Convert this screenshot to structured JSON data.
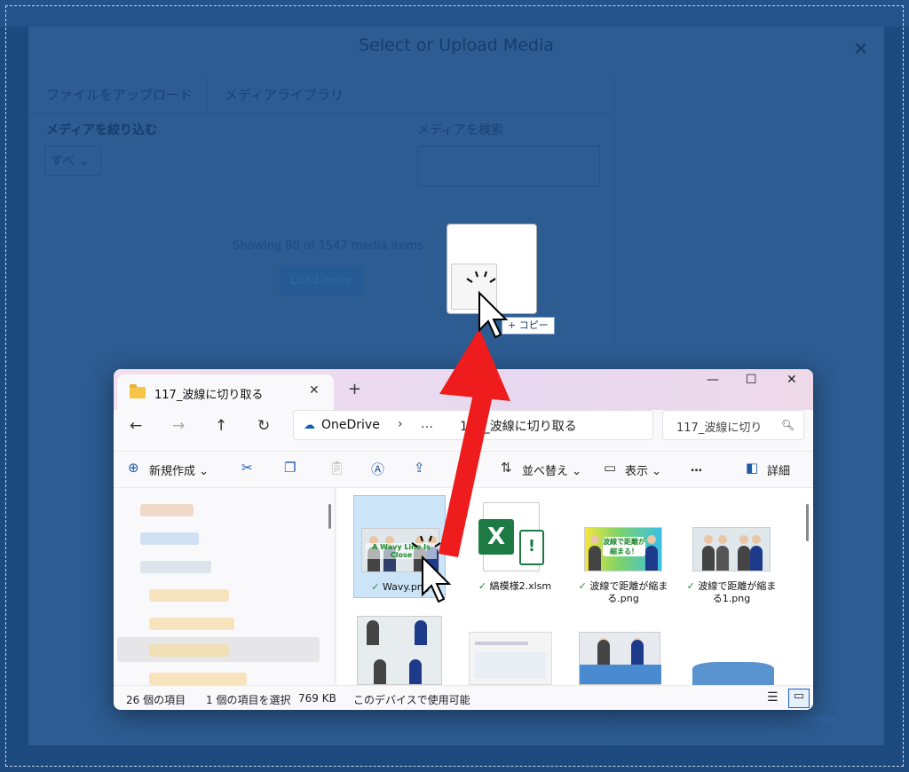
{
  "modal": {
    "title": "Select or Upload Media",
    "close": "×",
    "tabs": [
      "ファイルをアップロード",
      "メディアライブラリ"
    ],
    "filter_label": "メディアを絞り込む",
    "filter_value": "すべ",
    "search_label": "メディアを検索",
    "showing": "Showing 80 of 1547 media items",
    "load_more": "Load more",
    "select_button": "media"
  },
  "drag": {
    "copy_label": "+ コピー"
  },
  "explorer": {
    "tab_title": "117_波線に切り取る",
    "address": {
      "root": "OneDrive",
      "ellipsis": "…",
      "folder": "117_波線に切り取る"
    },
    "search_placeholder": "117_波線に切り",
    "toolbar": {
      "new": "新規作成",
      "sort": "並べ替え",
      "view": "表示",
      "more": "…",
      "details": "詳細"
    },
    "files": [
      {
        "name": "Wavy.png",
        "status": "✓",
        "selected": true,
        "thumb_text": "A Wavy Line Is Close"
      },
      {
        "name": "縞模様2.xlsm",
        "status": "✓"
      },
      {
        "name": "波線で距離が縮まる.png",
        "status": "✓",
        "thumb_text": "波線で距離が縮まる！"
      },
      {
        "name": "波線で距離が縮まる1.png",
        "status": "✓"
      }
    ],
    "status": {
      "count": "26 個の項目",
      "selected": "1 個の項目を選択",
      "size": "769 KB",
      "availability": "このデバイスで使用可能"
    }
  },
  "colors": {
    "overlay": "#1c4a7e",
    "arrow": "#ee1c1c",
    "selected_file": "#cce4f7"
  }
}
